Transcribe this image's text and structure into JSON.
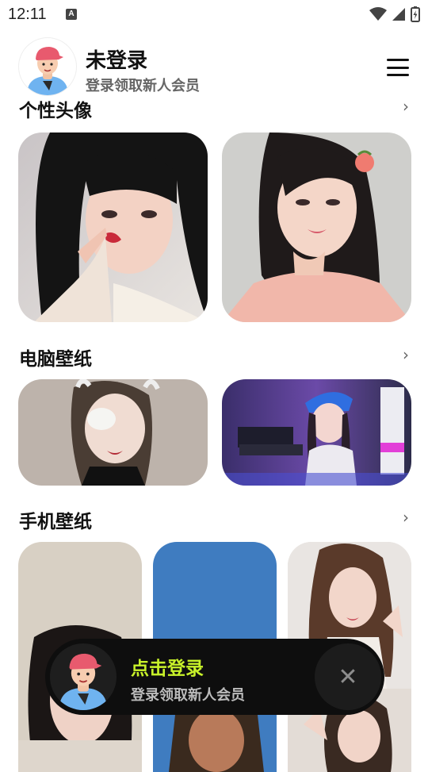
{
  "status_bar": {
    "time": "12:11",
    "a_badge": "A"
  },
  "header": {
    "title": "未登录",
    "subtitle": "登录领取新人会员",
    "menu_icon": "hamburger-menu-icon"
  },
  "sections": [
    {
      "title": "个性头像",
      "more_icon": "chevron-right-icon"
    },
    {
      "title": "电脑壁纸",
      "more_icon": "chevron-right-icon"
    },
    {
      "title": "手机壁纸",
      "more_icon": "chevron-right-icon"
    }
  ],
  "login_banner": {
    "title": "点击登录",
    "subtitle": "登录领取新人会员",
    "close_icon": "close-icon"
  },
  "colors": {
    "accent": "#c8f22a",
    "banner_bg": "#0e0e0e",
    "avatar_cap": "#e85a6e",
    "avatar_shirt": "#6fb3f0"
  }
}
